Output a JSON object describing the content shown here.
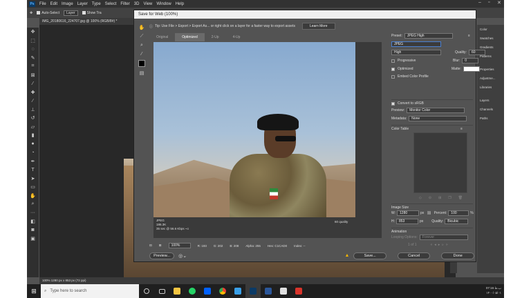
{
  "ps": {
    "logo": "Ps",
    "menu": [
      "File",
      "Edit",
      "Image",
      "Layer",
      "Type",
      "Select",
      "Filter",
      "3D",
      "View",
      "Window",
      "Help"
    ],
    "options": {
      "auto_select": "Auto-Select",
      "layer": "Layer",
      "show_tra": "Show Tra"
    },
    "doc_tab": "IMG_20180616_224707.jpg @ 100% (RGB/8#) *",
    "status": "100%        1280 px x 853 px (72 ppi)",
    "panels": [
      "Color",
      "Swatches",
      "Gradients",
      "Patterns",
      "Properties",
      "Adjustme...",
      "Libraries",
      "Layers",
      "Channels",
      "Paths"
    ]
  },
  "dialog": {
    "title": "Save for Web (100%)",
    "tip": "Tip: Use File > Export > Export As...  or right click on a layer for a faster way to export assets",
    "learn_more": "Learn More",
    "tabs": [
      "Original",
      "Optimized",
      "2-Up",
      "4-Up"
    ],
    "preview_info": [
      "JPEG",
      "186.3K",
      "35 sec @ 56.6 Kbps"
    ],
    "preview_quality": "60 quality",
    "readout": {
      "zoom": "100%",
      "r": "R: 193",
      "g": "G: 202",
      "b": "B: 208",
      "alpha": "Alpha: 255",
      "hex": "Hex: C1CAD0",
      "index": "Index: --"
    },
    "buttons": {
      "preview": "Preview...",
      "save": "Save...",
      "cancel": "Cancel",
      "done": "Done"
    },
    "settings": {
      "preset_label": "Preset:",
      "preset": "JPEG High",
      "format": "JPEG",
      "quality_level": "High",
      "quality_label": "Quality:",
      "quality": "60",
      "blur_label": "Blur:",
      "blur": "0",
      "progressive": "Progressive",
      "optimized": "Optimized",
      "matte_label": "Matte:",
      "embed_profile": "Embed Color Profile",
      "convert_srgb": "Convert to sRGB",
      "preview_label": "Preview:",
      "preview_mode": "Monitor Color",
      "metadata_label": "Metadata:",
      "metadata": "None",
      "color_table": "Color Table",
      "image_size": "Image Size",
      "w_label": "W:",
      "w": "1280",
      "h_label": "H:",
      "h": "853",
      "px": "px",
      "percent_label": "Percent:",
      "percent": "100",
      "pct": "%",
      "resample_label": "Quality:",
      "resample": "Bicubic",
      "animation": "Animation",
      "looping_label": "Looping Options:",
      "looping": "Forever",
      "frame": "1 of 1"
    }
  },
  "taskbar": {
    "search": "Type here to search",
    "time": "07:16 ب.ظ",
    "date": "۱۴۰۰/۰۵/۰۱"
  }
}
